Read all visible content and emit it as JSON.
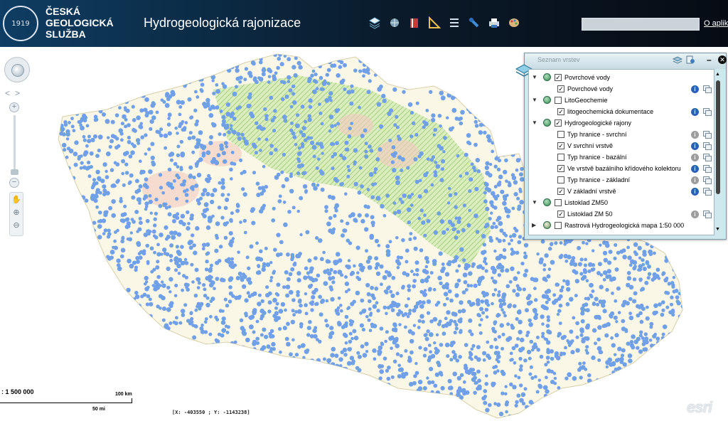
{
  "header": {
    "org_name_lines": [
      "ČESKÁ",
      "GEOLOGICKÁ",
      "SLUŽBA"
    ],
    "logo_year": "1919",
    "app_title": "Hydrogeologická rajonizace",
    "toolbar": [
      "layers-icon",
      "basemap-icon",
      "legend-book-icon",
      "measure-icon",
      "list-icon",
      "identify-pin-icon",
      "print-icon",
      "palette-icon"
    ],
    "search_value": "",
    "about_link": "O aplika"
  },
  "map": {
    "scale_label": ": 1 500 000",
    "scale_km": "100 km",
    "scale_mi": "50 mi",
    "coordinates": "[X: -403550 ; Y: -1143238]",
    "attribution": "esri",
    "colors": {
      "points": "#6fa0e8",
      "hatch": "#a8d07f",
      "background": "#ffffff"
    }
  },
  "layers_panel": {
    "title": "Seznam vrstev",
    "rows": [
      {
        "label": "Povrchové vody",
        "level": 0,
        "expanded": true,
        "checked": true,
        "info": false
      },
      {
        "label": "Povrchové vody",
        "level": 1,
        "checked": true,
        "info": true
      },
      {
        "label": "LitoGeochemie",
        "level": 0,
        "expanded": true,
        "checked": false,
        "info": false
      },
      {
        "label": "litogeochemická dokumentace",
        "level": 1,
        "checked": true,
        "info": true
      },
      {
        "label": "Hydrogeologické rajony",
        "level": 0,
        "expanded": true,
        "checked": true,
        "info": false
      },
      {
        "label": "Typ hranice - svrchní",
        "level": 1,
        "checked": false,
        "info": true,
        "info_off": true
      },
      {
        "label": "V svrchní vrstvě",
        "level": 1,
        "checked": true,
        "info": true
      },
      {
        "label": "Typ hranice - bazální",
        "level": 1,
        "checked": false,
        "info": true,
        "info_off": true
      },
      {
        "label": "Ve vrstvě bazálního křídového kolektoru",
        "level": 1,
        "checked": true,
        "info": true
      },
      {
        "label": "Typ hranice - základní",
        "level": 1,
        "checked": false,
        "info": true,
        "info_off": true
      },
      {
        "label": "V základní vrstvě",
        "level": 1,
        "checked": true,
        "info": true
      },
      {
        "label": "Listoklad ZM50",
        "level": 0,
        "expanded": true,
        "checked": false,
        "info": false
      },
      {
        "label": "Listoklad ZM 50",
        "level": 1,
        "checked": true,
        "info": true,
        "info_off": true
      },
      {
        "label": "Rastrová Hydrogeologická mapa 1:50 000",
        "level": 0,
        "expanded": false,
        "checked": false,
        "info": false,
        "raster": true
      }
    ]
  }
}
